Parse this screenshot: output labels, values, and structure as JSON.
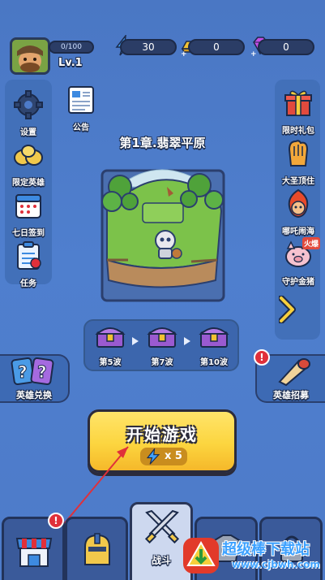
{
  "player": {
    "xp": "0/100",
    "level": "Lv.1"
  },
  "resources": [
    {
      "name": "energy",
      "icon": "lightning-icon",
      "value": "30"
    },
    {
      "name": "gold",
      "icon": "gold-bar-icon",
      "value": "0"
    },
    {
      "name": "gems",
      "icon": "gem-icon",
      "value": "0"
    }
  ],
  "left_menu": [
    {
      "label": "设置",
      "icon": "gear-icon"
    },
    {
      "label": "限定英雄",
      "icon": "hero-icon"
    },
    {
      "label": "七日签到",
      "icon": "calendar-icon"
    },
    {
      "label": "任务",
      "icon": "task-clipboard-icon"
    }
  ],
  "notice": {
    "label": "公告",
    "icon": "notice-board-icon"
  },
  "right_menu": [
    {
      "label": "限时礼包",
      "icon": "gift-box-icon"
    },
    {
      "label": "大圣顶住",
      "icon": "monkey-king-icon"
    },
    {
      "label": "哪吒闹海",
      "icon": "nezha-icon"
    },
    {
      "label": "守护金猪",
      "icon": "golden-pig-icon",
      "tag": "火爆"
    }
  ],
  "chapter": {
    "title": "第1章.翡翠平原"
  },
  "waves": [
    {
      "label": "第5波"
    },
    {
      "label": "第7波"
    },
    {
      "label": "第10波"
    }
  ],
  "hero_exchange": {
    "label": "英雄兑换"
  },
  "hero_recruit": {
    "label": "英雄招募"
  },
  "start": {
    "label": "开始游戏",
    "cost": "x 5"
  },
  "nav": {
    "active_label": "战斗",
    "badge": "!"
  },
  "watermark": {
    "title": "超级棒下载站",
    "url": "www.cjbwh.com"
  },
  "colors": {
    "background": "#4d7bc9",
    "start_button": "#fcd53f",
    "badge": "#e0303a",
    "energy": "#3fa0ff",
    "gold": "#f2c232",
    "gem": "#c34ee6"
  }
}
